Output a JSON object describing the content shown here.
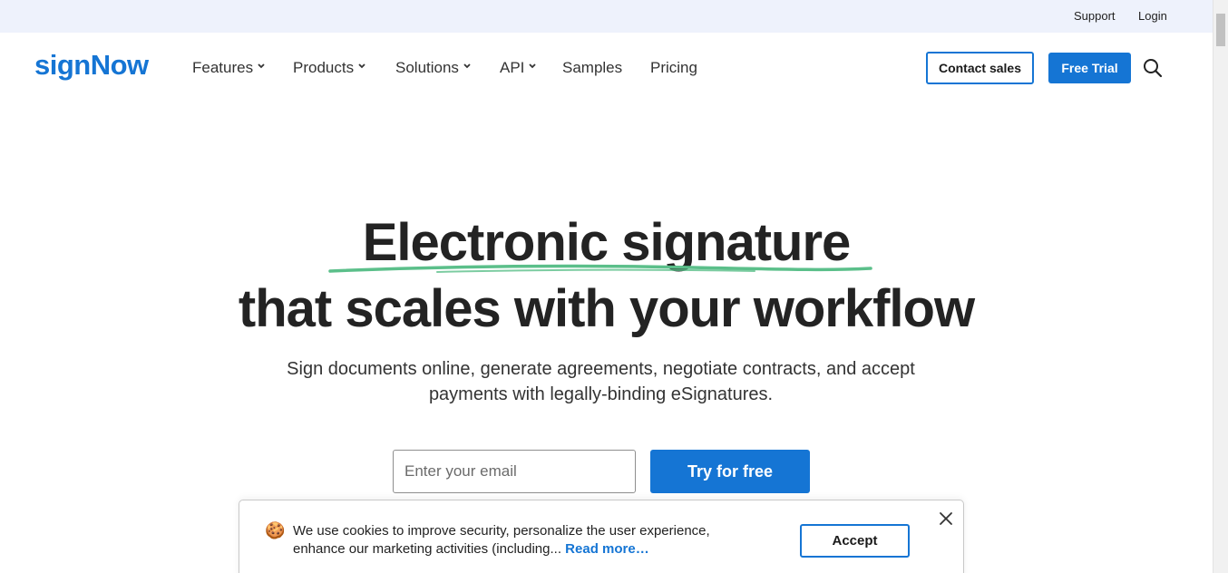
{
  "topbar": {
    "support": "Support",
    "login": "Login"
  },
  "nav": {
    "logo": "signNow",
    "items": [
      {
        "label": "Features",
        "has_dropdown": true
      },
      {
        "label": "Products",
        "has_dropdown": true
      },
      {
        "label": "Solutions",
        "has_dropdown": true
      },
      {
        "label": "API",
        "has_dropdown": true
      },
      {
        "label": "Samples",
        "has_dropdown": false
      },
      {
        "label": "Pricing",
        "has_dropdown": false
      }
    ],
    "contact_sales": "Contact sales",
    "free_trial": "Free Trial",
    "search_icon": "search-icon"
  },
  "hero": {
    "title_line1": "Electronic signature",
    "title_line2": "that scales with your workflow",
    "subtitle_line1": "Sign documents online, generate agreements, negotiate contracts, and accept",
    "subtitle_line2": "payments with legally-binding eSignatures.",
    "email_placeholder": "Enter your email",
    "cta": "Try for free"
  },
  "cookie_banner": {
    "text_line1": "We use cookies to improve security, personalize the user experience,",
    "text_line2": "enhance our marketing activities (including...",
    "read_more": "Read more…",
    "accept": "Accept",
    "icon": "cookie-icon"
  },
  "colors": {
    "brand": "#1575d4",
    "topbar_bg": "#eef2fc",
    "underline_green": "#5bbf8a",
    "heading": "#232323"
  }
}
